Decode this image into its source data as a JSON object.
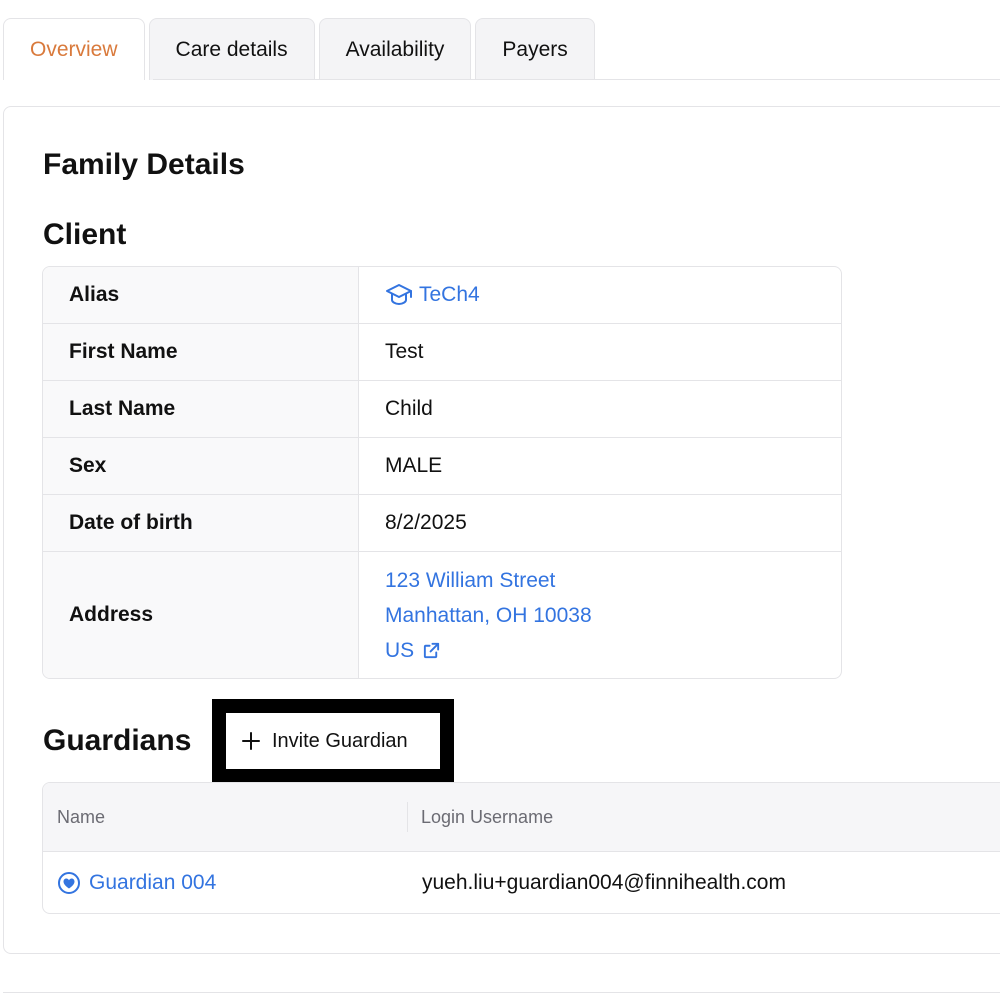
{
  "tabs": [
    {
      "label": "Overview",
      "active": true
    },
    {
      "label": "Care details",
      "active": false
    },
    {
      "label": "Availability",
      "active": false
    },
    {
      "label": "Payers",
      "active": false
    }
  ],
  "page_title": "Family Details",
  "client": {
    "section_title": "Client",
    "rows": {
      "alias": {
        "label": "Alias",
        "value": "TeCh4",
        "icon": "graduation-cap-icon"
      },
      "first_name": {
        "label": "First Name",
        "value": "Test"
      },
      "last_name": {
        "label": "Last Name",
        "value": "Child"
      },
      "sex": {
        "label": "Sex",
        "value": "MALE"
      },
      "dob": {
        "label": "Date of birth",
        "value": "8/2/2025"
      },
      "address": {
        "label": "Address",
        "line1": "123 William Street",
        "line2": "Manhattan, OH 10038",
        "line3": "US",
        "icon": "external-link-icon"
      }
    }
  },
  "guardians": {
    "section_title": "Guardians",
    "invite_label": "Invite Guardian",
    "columns": {
      "name": "Name",
      "login": "Login Username"
    },
    "rows": [
      {
        "name": "Guardian 004",
        "login": "yueh.liu+guardian004@finnihealth.com",
        "icon": "heart-circle-icon"
      }
    ]
  },
  "colors": {
    "accent": "#d97a3c",
    "link": "#3374e0",
    "border": "#e4e4e7"
  }
}
